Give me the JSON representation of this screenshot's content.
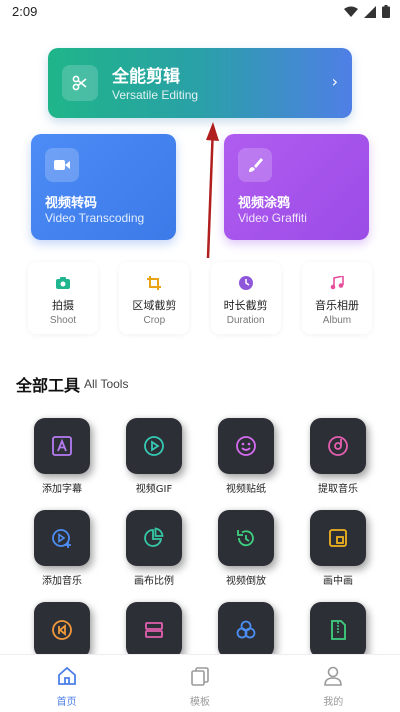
{
  "status": {
    "time": "2:09"
  },
  "hero": {
    "title": "全能剪辑",
    "subtitle": "Versatile Editing",
    "icon": "scissors-icon"
  },
  "cards": [
    {
      "title": "视频转码",
      "subtitle": "Video Transcoding",
      "icon": "video-camera-icon"
    },
    {
      "title": "视频涂鸦",
      "subtitle": "Video Graffiti",
      "icon": "brush-icon"
    }
  ],
  "quick": [
    {
      "label": "拍摄",
      "sub": "Shoot",
      "icon": "camera-icon",
      "color": "#1fb58f"
    },
    {
      "label": "区域截剪",
      "sub": "Crop",
      "icon": "crop-icon",
      "color": "#e8a317"
    },
    {
      "label": "时长截剪",
      "sub": "Duration",
      "icon": "clock-icon",
      "color": "#8e57d9"
    },
    {
      "label": "音乐相册",
      "sub": "Album",
      "icon": "music-note-icon",
      "color": "#e64e9c"
    }
  ],
  "section": {
    "title": "全部工具",
    "subtitle": "All Tools"
  },
  "tools": [
    {
      "label": "添加字幕",
      "icon": "subtitle-icon",
      "color": "#b57cf2"
    },
    {
      "label": "视频GIF",
      "icon": "gif-play-icon",
      "color": "#36c9b4"
    },
    {
      "label": "视频贴纸",
      "icon": "sticker-icon",
      "color": "#d56cf0"
    },
    {
      "label": "提取音乐",
      "icon": "extract-music-icon",
      "color": "#e35fb0"
    },
    {
      "label": "添加音乐",
      "icon": "add-music-icon",
      "color": "#4d8ef5"
    },
    {
      "label": "画布比例",
      "icon": "pie-ratio-icon",
      "color": "#35c7a5"
    },
    {
      "label": "视频倒放",
      "icon": "reverse-icon",
      "color": "#3fd07f"
    },
    {
      "label": "画中画",
      "icon": "picture-in-picture-icon",
      "color": "#f2b31f"
    },
    {
      "label": "",
      "icon": "rewind-icon",
      "color": "#f09a3c"
    },
    {
      "label": "",
      "icon": "split-icon",
      "color": "#e35fb0"
    },
    {
      "label": "",
      "icon": "circles-icon",
      "color": "#4d8ef5"
    },
    {
      "label": "",
      "icon": "zip-file-icon",
      "color": "#3fd07f"
    }
  ],
  "nav": [
    {
      "label": "首页",
      "icon": "home-icon",
      "active": true
    },
    {
      "label": "模板",
      "icon": "template-icon",
      "active": false
    },
    {
      "label": "我的",
      "icon": "profile-icon",
      "active": false
    }
  ],
  "colors": {
    "nav_active": "#4d7fe8",
    "nav_inactive": "#9a9a9a",
    "arrow": "#b01e1e"
  }
}
